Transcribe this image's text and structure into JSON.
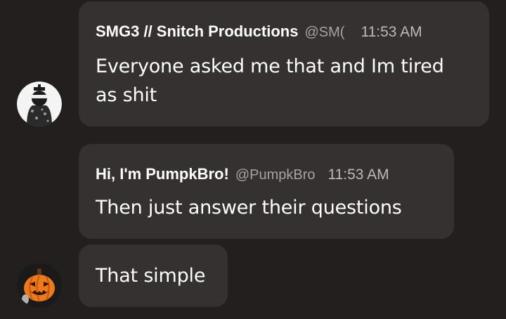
{
  "messages": [
    {
      "author": "SMG3 // Snitch Productions",
      "handle": "@SM(",
      "time": "11:53 AM",
      "lines": [
        "Everyone asked me that and Im tired",
        "as shit"
      ],
      "avatar_icon": "hooded-figure-avatar-icon"
    },
    {
      "author": "Hi, I'm PumpkBro!",
      "handle": "@PumpkBro",
      "time": "11:53 AM",
      "lines": [
        "Then just answer their questions"
      ],
      "avatar_icon": "pumpkin-avatar-icon"
    },
    {
      "lines": [
        "That simple"
      ]
    }
  ],
  "colors": {
    "background": "#221f1e",
    "bubble": "#343130",
    "author": "#ffffff",
    "handle": "#a7a3a1",
    "time": "#bdb9b7",
    "text": "#ffffff"
  }
}
